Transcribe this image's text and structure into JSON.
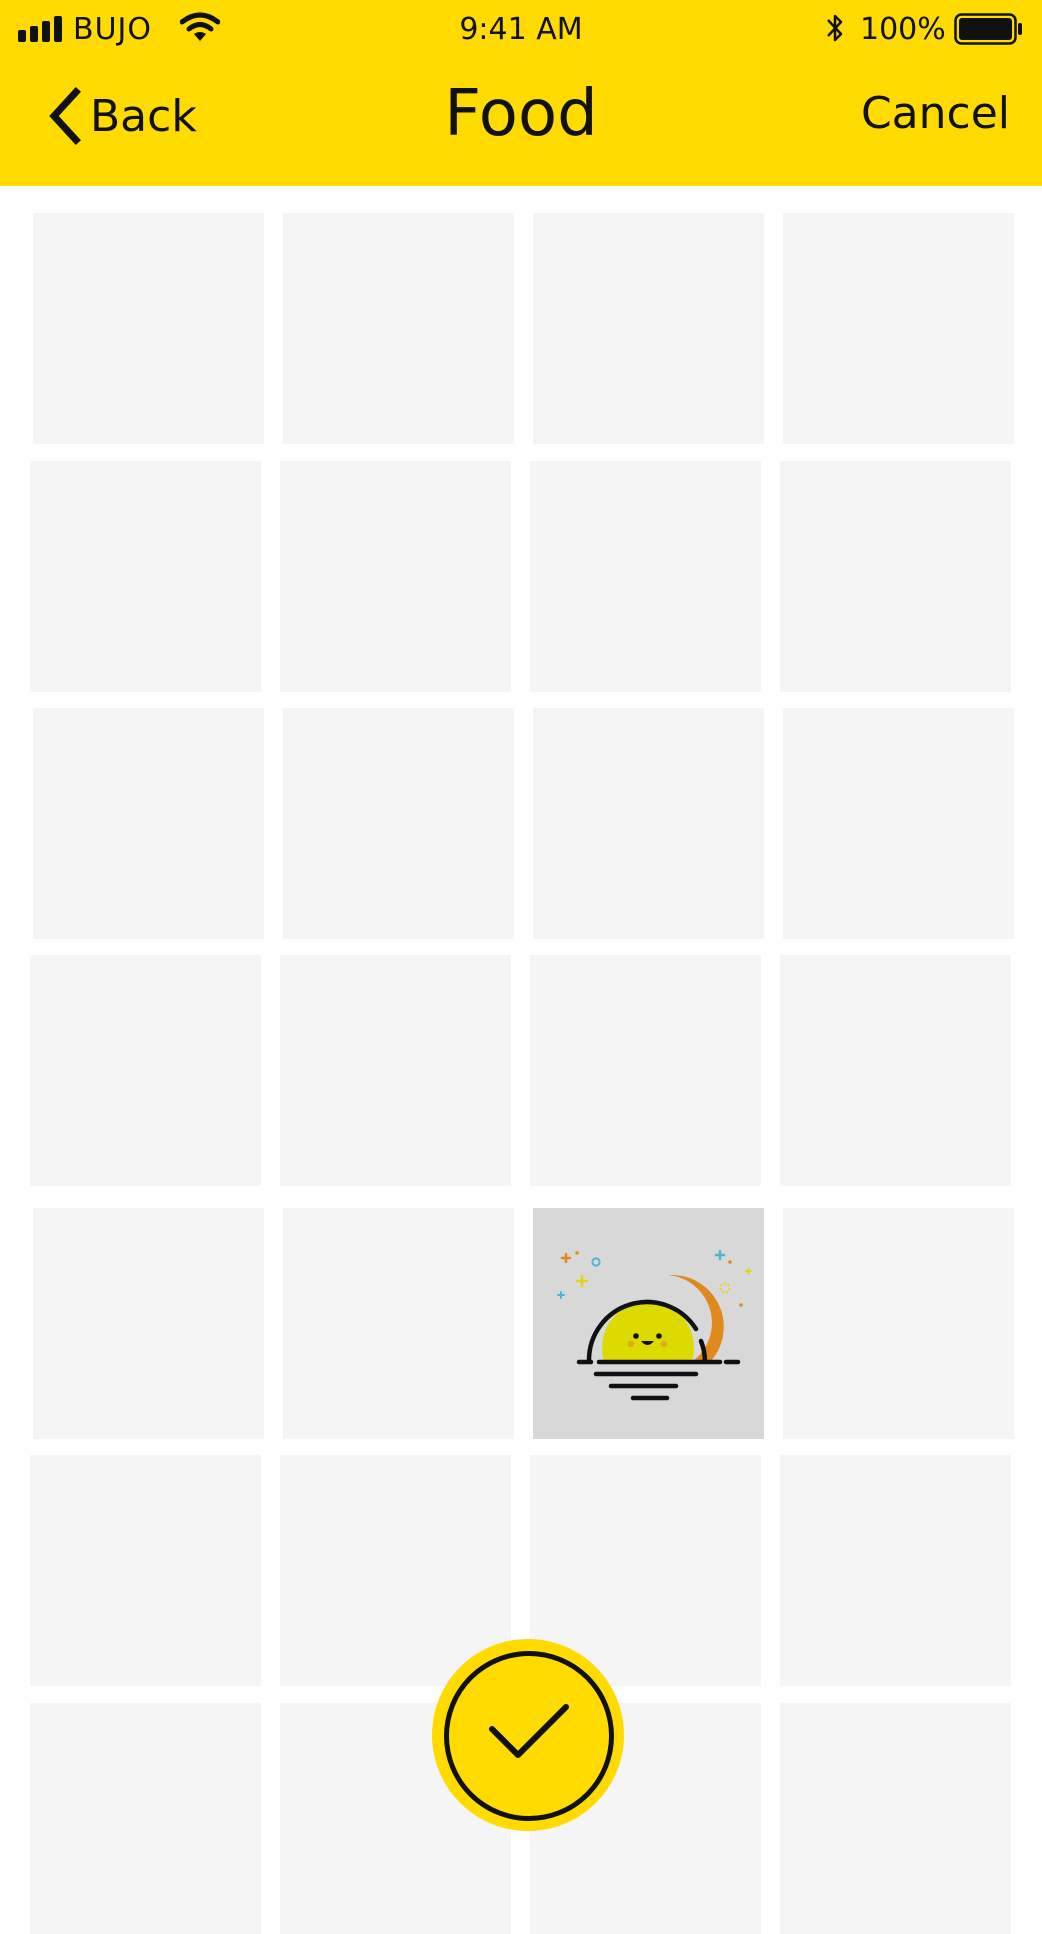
{
  "status_bar": {
    "carrier": "BUJO",
    "time": "9:41 AM",
    "battery_percent": "100%",
    "icons": [
      "signal-icon",
      "wifi-icon",
      "bluetooth-icon",
      "battery-icon"
    ]
  },
  "nav": {
    "back_label": "Back",
    "title": "Food",
    "cancel_label": "Cancel"
  },
  "grid": {
    "rows": 7,
    "columns": 4,
    "selected_index": 18,
    "selected_icon": "sunrise-icon"
  },
  "confirm": {
    "icon": "checkmark-icon"
  },
  "colors": {
    "accent": "#FFDB00",
    "tile": "#F5F5F5",
    "tile_selected": "#D8D8D8",
    "text": "#111111"
  }
}
